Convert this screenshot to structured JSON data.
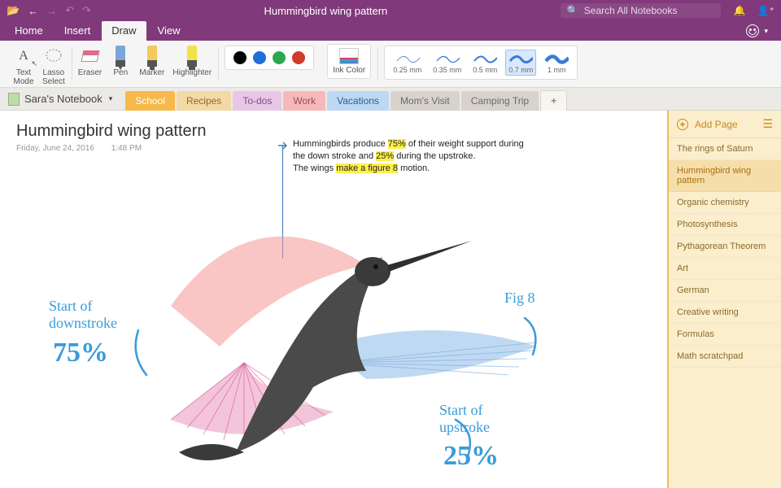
{
  "window": {
    "title": "Hummingbird wing pattern"
  },
  "search": {
    "placeholder": "Search All Notebooks"
  },
  "menu": {
    "tabs": [
      "Home",
      "Insert",
      "Draw",
      "View"
    ],
    "active_index": 2
  },
  "ribbon": {
    "text_mode": "Text\nMode",
    "lasso": "Lasso\nSelect",
    "eraser": "Eraser",
    "pen": "Pen",
    "marker": "Marker",
    "highlighter": "Highlighter",
    "ink_color": "Ink Color",
    "colors": [
      "#000000",
      "#1e6fd9",
      "#2aa84f",
      "#d23a2e"
    ],
    "thickness": [
      {
        "label": "0.25 mm"
      },
      {
        "label": "0.35 mm"
      },
      {
        "label": "0.5 mm"
      },
      {
        "label": "0.7 mm"
      },
      {
        "label": "1 mm"
      }
    ],
    "thickness_selected_index": 3
  },
  "notebook": {
    "name": "Sara's Notebook"
  },
  "sections": [
    {
      "label": "School",
      "color": "#f6b94a",
      "text": "#ffffff"
    },
    {
      "label": "Recipes",
      "color": "#f3d9a4",
      "text": "#8a6a2a"
    },
    {
      "label": "To-dos",
      "color": "#e9c6e6",
      "text": "#7a4f87"
    },
    {
      "label": "Work",
      "color": "#f6b9bb",
      "text": "#9c4a52"
    },
    {
      "label": "Vacations",
      "color": "#bcd8f3",
      "text": "#2f5e8e"
    },
    {
      "label": "Mom's Visit",
      "color": "#d7d2cc",
      "text": "#6a6a6a"
    },
    {
      "label": "Camping Trip",
      "color": "#d7d2cc",
      "text": "#6a6a6a"
    }
  ],
  "sections_active_index": 0,
  "page": {
    "title": "Hummingbird wing pattern",
    "date": "Friday, June 24, 2016",
    "time": "1:48 PM",
    "note_line1_a": "Hummingbirds produce ",
    "note_line1_hl1": "75%",
    "note_line1_b": " of their weight support during",
    "note_line2_a": "the down stroke and ",
    "note_line2_hl2": "25%",
    "note_line2_b": " during the upstroke.",
    "note_line3_a": "The wings ",
    "note_line3_hl3": "make a figure 8",
    "note_line3_b": " motion.",
    "hand_down_label": "Start of\ndownstroke",
    "hand_down_pct": "75%",
    "hand_up_label": "Start of\nupstroke",
    "hand_up_pct": "25%",
    "hand_fig8": "Fig 8"
  },
  "sidebar": {
    "add_label": "Add Page",
    "pages": [
      "The rings of Saturn",
      "Hummingbird wing pattern",
      "Organic chemistry",
      "Photosynthesis",
      "Pythagorean Theorem",
      "Art",
      "German",
      "Creative writing",
      "Formulas",
      "Math scratchpad"
    ],
    "selected_index": 1
  }
}
